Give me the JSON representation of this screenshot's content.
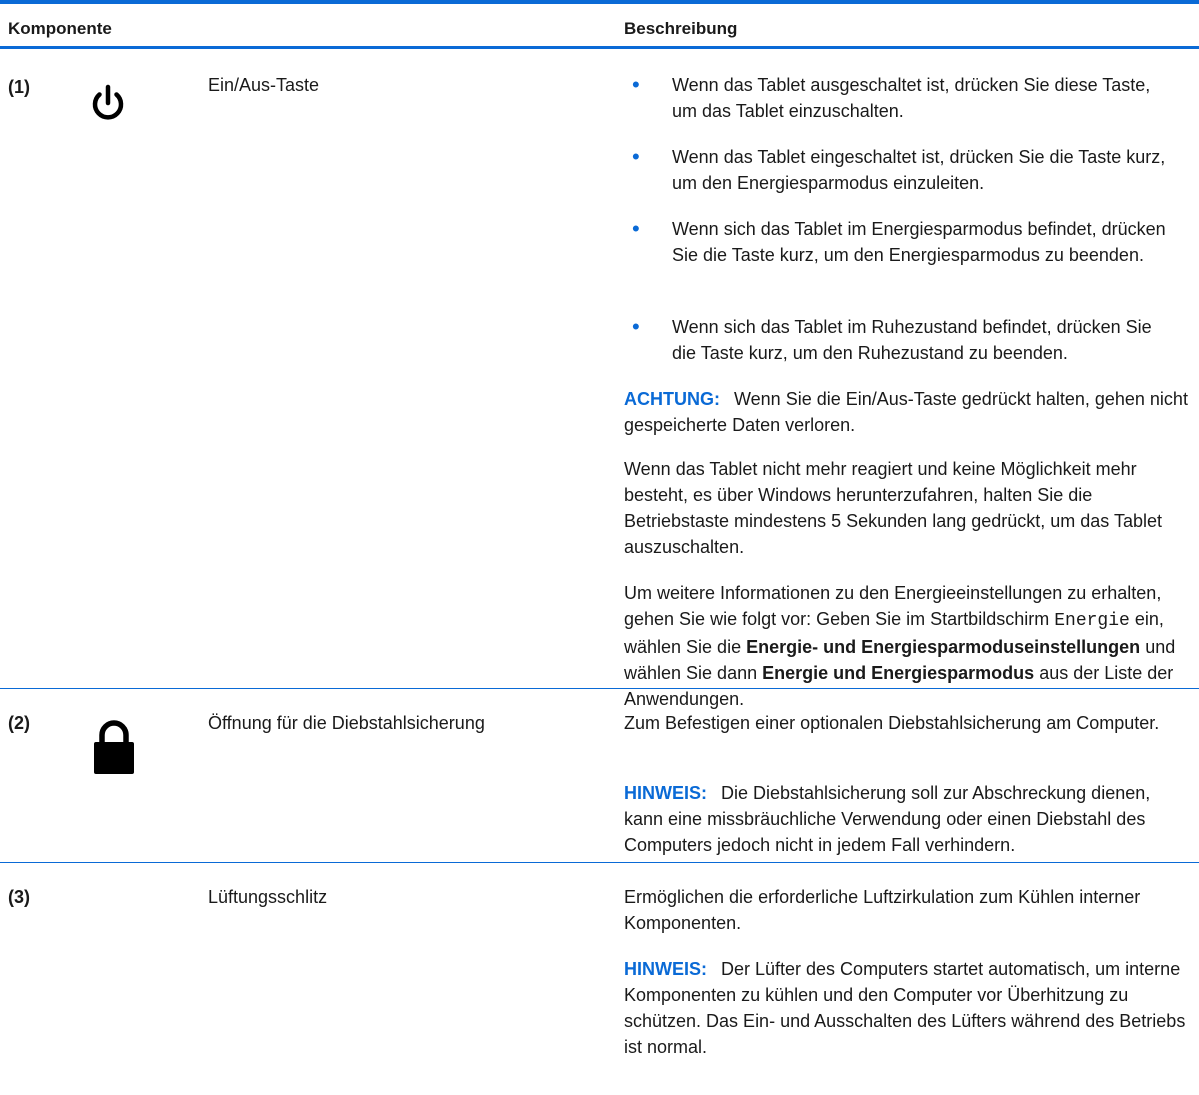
{
  "header": {
    "col_component": "Komponente",
    "col_description": "Beschreibung"
  },
  "rows": [
    {
      "num": "(1)",
      "icon": "power-icon",
      "name": "Ein/Aus-Taste",
      "bullets": [
        "Wenn das Tablet ausgeschaltet ist, drücken Sie diese Taste, um das Tablet einzuschalten.",
        "Wenn das Tablet eingeschaltet ist, drücken Sie die Taste kurz, um den Energiesparmodus einzuleiten.",
        "Wenn sich das Tablet im Energiesparmodus befindet, drücken Sie die Taste kurz, um den Energiesparmodus zu beenden.",
        "Wenn sich das Tablet im Ruhezustand befindet, drücken Sie die Taste kurz, um den Ruhezustand zu beenden."
      ],
      "caution_label": "ACHTUNG:",
      "caution_text": "Wenn Sie die Ein/Aus-Taste gedrückt halten, gehen nicht gespeicherte Daten verloren.",
      "para1": "Wenn das Tablet nicht mehr reagiert und keine Möglichkeit mehr besteht, es über Windows herunterzufahren, halten Sie die Betriebstaste mindestens 5 Sekunden lang gedrückt, um das Tablet auszuschalten.",
      "para2_a": "Um weitere Informationen zu den Energieeinstellungen zu erhalten, gehen Sie wie folgt vor: Geben Sie im Startbildschirm",
      "para2_code": "Energie",
      "para2_b": "ein, wählen Sie die",
      "para2_bold1": "Energie- und Energiesparmoduseinstellungen",
      "para2_c": "und wählen Sie dann",
      "para2_bold2": "Energie und Energiesparmodus",
      "para2_d": "aus der Liste der Anwendungen."
    },
    {
      "num": "(2)",
      "icon": "lock-icon",
      "name": "Öffnung für die Diebstahlsicherung",
      "desc": "Zum Befestigen einer optionalen Diebstahlsicherung am Computer.",
      "note_label": "HINWEIS:",
      "note_text": "Die Diebstahlsicherung soll zur Abschreckung dienen, kann eine missbräuchliche Verwendung oder einen Diebstahl des Computers jedoch nicht in jedem Fall verhindern."
    },
    {
      "num": "(3)",
      "name": "Lüftungsschlitz",
      "desc": "Ermöglichen die erforderliche Luftzirkulation zum Kühlen interner Komponenten.",
      "note_label": "HINWEIS:",
      "note_text": "Der Lüfter des Computers startet automatisch, um interne Komponenten zu kühlen und den Computer vor Überhitzung zu schützen. Das Ein- und Ausschalten des Lüfters während des Betriebs ist normal."
    }
  ],
  "colors": {
    "accent": "#0a6ad6",
    "text": "#1a1a1a"
  }
}
